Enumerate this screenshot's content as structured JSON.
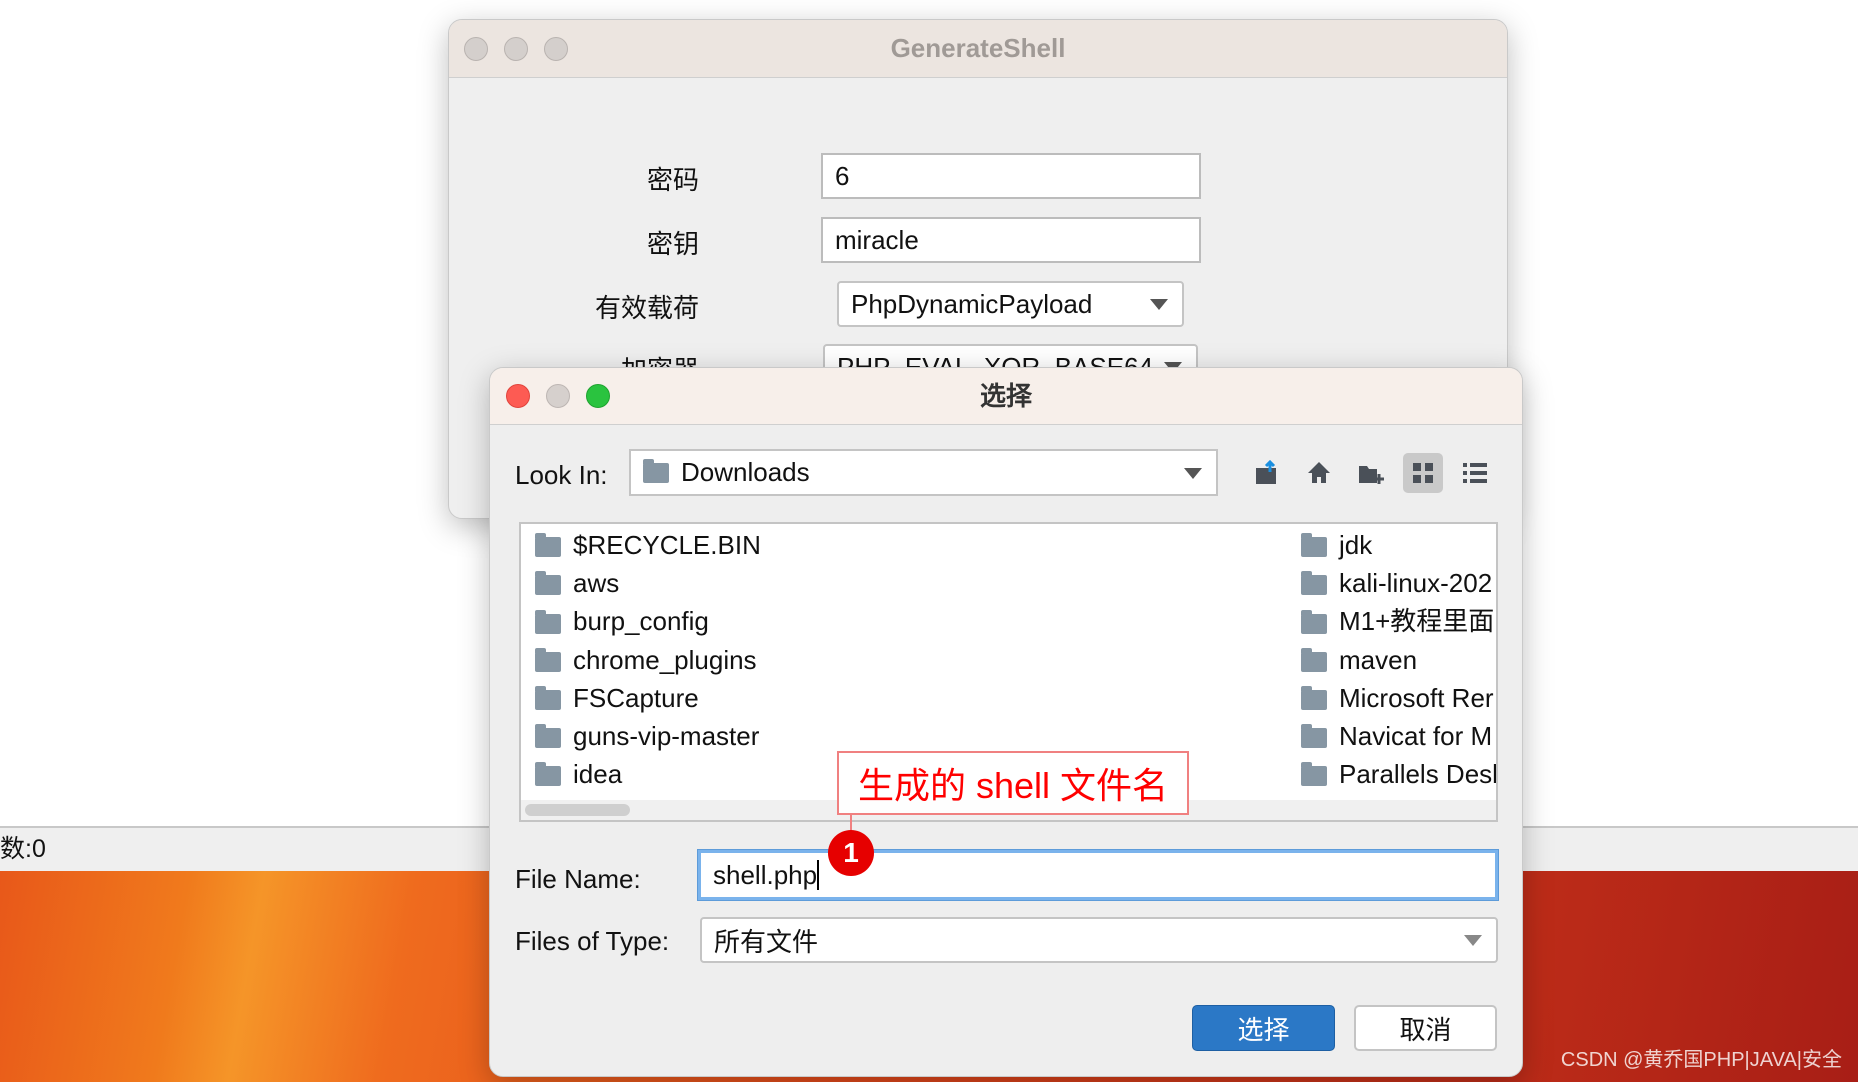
{
  "background": {
    "status_text": "数:0",
    "watermark": "CSDN @黄乔国PHP|JAVA|安全"
  },
  "generate_shell": {
    "title": "GenerateShell",
    "fields": [
      {
        "label": "密码",
        "value": "6"
      },
      {
        "label": "密钥",
        "value": "miracle"
      }
    ],
    "payload": {
      "label": "有效载荷",
      "value": "PhpDynamicPayload"
    },
    "cryption": {
      "label": "加密器",
      "value": "PHP_EVAL_XOR_BASE64"
    }
  },
  "dialog": {
    "title": "选择",
    "look_in_label": "Look In:",
    "look_in_value": "Downloads",
    "toolbar": [
      "up-folder-icon",
      "home-icon",
      "new-folder-icon",
      "grid-view-icon",
      "list-view-icon"
    ],
    "files_col1": [
      "$RECYCLE.BIN",
      "aws",
      "burp_config",
      "chrome_plugins",
      "FSCapture",
      "guns-vip-master",
      "idea"
    ],
    "files_col2": [
      "jdk",
      "kali-linux-202",
      "M1+教程里面",
      "maven",
      "Microsoft Rer",
      "Navicat for M",
      "Parallels Desl"
    ],
    "file_name_label": "File Name:",
    "file_name_value": "shell.php",
    "file_type_label": "Files of Type:",
    "file_type_value": "所有文件",
    "confirm_label": "选择",
    "cancel_label": "取消"
  },
  "annotation": {
    "text": "生成的 shell 文件名",
    "badge": "1",
    "color": "#ff0000"
  }
}
